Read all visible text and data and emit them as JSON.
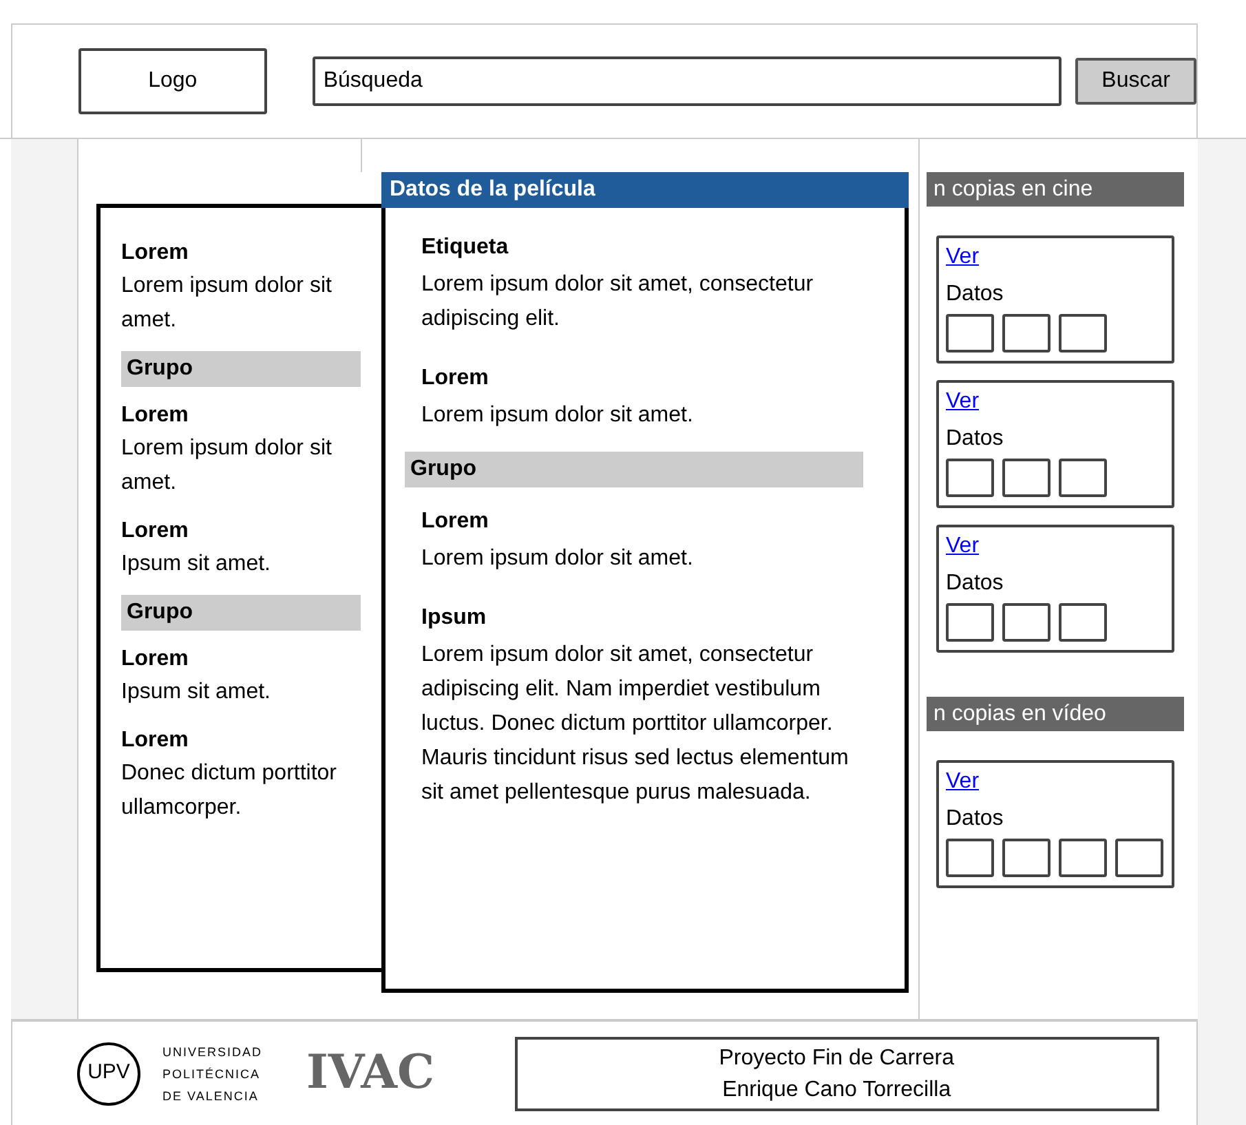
{
  "header": {
    "logo": "Logo",
    "search": {
      "value": "Búsqueda"
    },
    "button": "Buscar"
  },
  "left_panel": {
    "items": [
      {
        "kind": "field",
        "label": "Lorem",
        "text": "Lorem ipsum dolor sit amet."
      },
      {
        "kind": "group",
        "label": "Grupo"
      },
      {
        "kind": "field",
        "label": "Lorem",
        "text": "Lorem ipsum dolor sit amet."
      },
      {
        "kind": "field",
        "label": "Lorem",
        "text": "Ipsum sit amet."
      },
      {
        "kind": "group",
        "label": "Grupo"
      },
      {
        "kind": "field",
        "label": "Lorem",
        "text": "Ipsum sit amet."
      },
      {
        "kind": "field",
        "label": "Lorem",
        "text": "Donec dictum porttitor ullamcorper."
      }
    ]
  },
  "details": {
    "title": "Datos de la película",
    "items": [
      {
        "kind": "field",
        "label": "Etiqueta",
        "text": "Lorem ipsum dolor sit amet, consectetur adipiscing elit."
      },
      {
        "kind": "field",
        "label": "Lorem",
        "text": "Lorem ipsum dolor sit amet."
      },
      {
        "kind": "group",
        "label": "Grupo"
      },
      {
        "kind": "field",
        "label": "Lorem",
        "text": "Lorem ipsum dolor sit amet."
      },
      {
        "kind": "field",
        "label": "Ipsum",
        "text": "Lorem ipsum dolor sit amet, consectetur adipiscing elit. Nam imperdiet vestibulum luctus. Donec dictum porttitor ullamcorper. Mauris tincidunt risus sed lectus elementum sit amet pellentesque purus malesuada."
      }
    ]
  },
  "sidebar": {
    "sections": [
      {
        "title": "n copias en cine",
        "cards": [
          {
            "link": "Ver",
            "label": "Datos",
            "slots": [
              {
                "kind": "box"
              },
              {
                "kind": "box"
              },
              {
                "kind": "box"
              }
            ]
          },
          {
            "link": "Ver",
            "label": "Datos",
            "slots": [
              {
                "kind": "box"
              },
              {
                "kind": "box"
              },
              {
                "kind": "box"
              }
            ]
          },
          {
            "link": "Ver",
            "label": "Datos",
            "slots": [
              {
                "kind": "box"
              },
              {
                "kind": "box"
              },
              {
                "kind": "box"
              }
            ]
          }
        ]
      },
      {
        "title": "n copias en vídeo",
        "cards": [
          {
            "link": "Ver",
            "label": "Datos",
            "slots": [
              {
                "kind": "box"
              },
              {
                "kind": "box"
              },
              {
                "kind": "box"
              },
              {
                "kind": "box"
              }
            ]
          }
        ]
      }
    ]
  },
  "footer": {
    "university_logo": "UPV",
    "university_name": [
      "UNIVERSIDAD",
      "POLITÉCNICA",
      "DE VALENCIA"
    ],
    "app_name": "IVAC",
    "credits": [
      "Proyecto Fin de Carrera",
      "Enrique Cano Torrecilla"
    ]
  }
}
